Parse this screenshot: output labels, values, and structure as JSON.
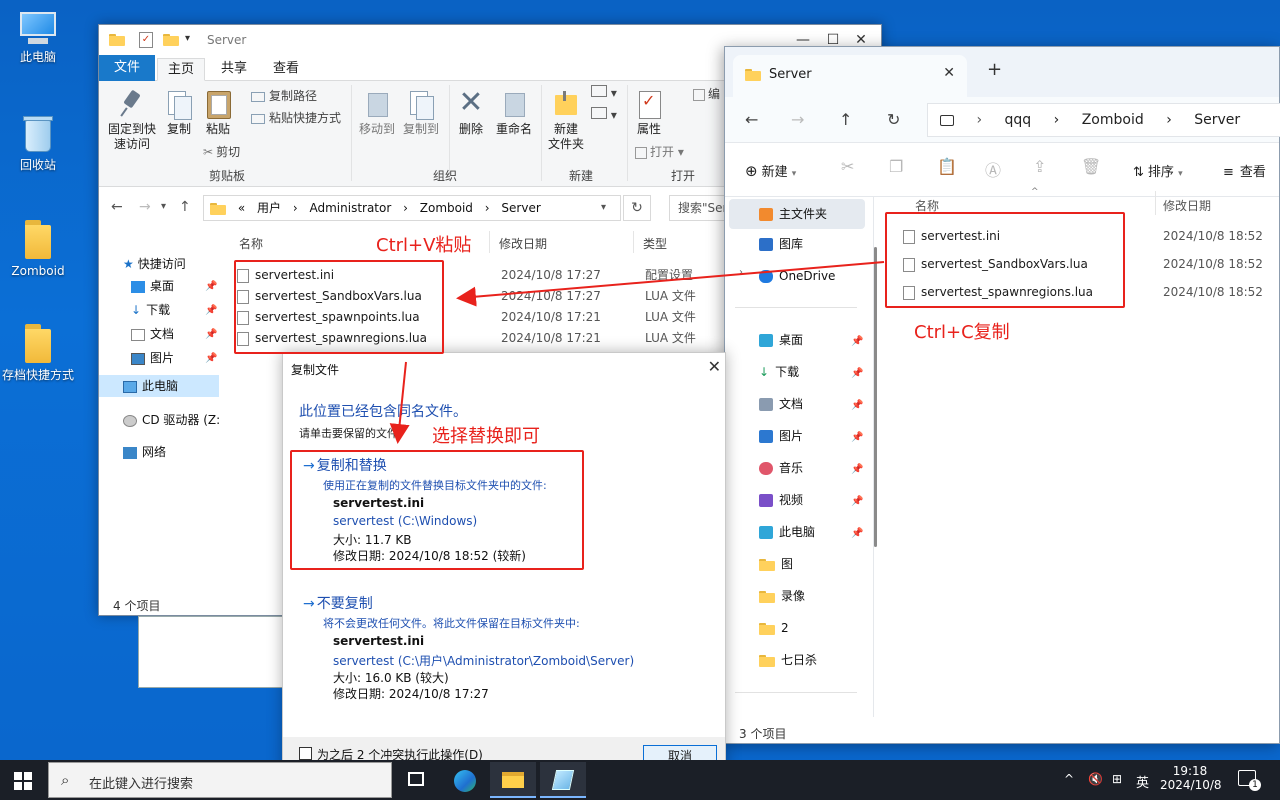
{
  "desktop": {
    "icons": [
      {
        "label": "此电脑",
        "icon": "computer-icon"
      },
      {
        "label": "回收站",
        "icon": "recycle-bin-icon"
      },
      {
        "label": "Zomboid",
        "icon": "folder-icon"
      },
      {
        "label": "存档快捷方式",
        "icon": "shortcut-folder-icon"
      }
    ]
  },
  "win1": {
    "title": "Server",
    "tabs": [
      "文件",
      "主页",
      "共享",
      "查看"
    ],
    "ribbon": {
      "pin_label": [
        "固定到快",
        "速访问"
      ],
      "copy_label": "复制",
      "paste_label": "粘贴",
      "copy_path": "复制路径",
      "paste_shortcut": "粘贴快捷方式",
      "cut": "剪切",
      "clipboard_group": "剪贴板",
      "move_to": "移动到",
      "copy_to": "复制到",
      "delete": "删除",
      "rename": "重命名",
      "organize_group": "组织",
      "new_folder": [
        "新建",
        "文件夹"
      ],
      "new_group": "新建",
      "properties": "属性",
      "open": "打开",
      "edit": "编",
      "open_group": "打开"
    },
    "address": [
      "«",
      "用户",
      "›",
      "Administrator",
      "›",
      "Zomboid",
      "›",
      "Server"
    ],
    "search_placeholder": "搜索\"Ser",
    "nav": {
      "quick_access": "快捷访问",
      "items": [
        "桌面",
        "下载",
        "文档",
        "图片"
      ],
      "this_pc": "此电脑",
      "cd_drive": "CD 驱动器 (Z:",
      "network": "网络"
    },
    "columns": {
      "name": "名称",
      "date": "修改日期",
      "type": "类型"
    },
    "files": [
      {
        "name": "servertest.ini",
        "date": "2024/10/8 17:27",
        "type": "配置设置"
      },
      {
        "name": "servertest_SandboxVars.lua",
        "date": "2024/10/8 17:27",
        "type": "LUA 文件"
      },
      {
        "name": "servertest_spawnpoints.lua",
        "date": "2024/10/8 17:21",
        "type": "LUA 文件"
      },
      {
        "name": "servertest_spawnregions.lua",
        "date": "2024/10/8 17:21",
        "type": "LUA 文件"
      }
    ],
    "status": "4 个项目"
  },
  "win2": {
    "tab_title": "Server",
    "breadcrumb": [
      "qqq",
      "›",
      "Zomboid",
      "›",
      "Server"
    ],
    "toolbar": {
      "new": "新建",
      "sort": "排序",
      "view": "查看"
    },
    "sidebar": {
      "home": "主文件夹",
      "gallery": "图库",
      "onedrive": "OneDrive",
      "items": [
        "桌面",
        "下载",
        "文档",
        "图片",
        "音乐",
        "视频",
        "此电脑",
        "图",
        "录像",
        "2",
        "七日杀"
      ]
    },
    "columns": {
      "name": "名称",
      "date": "修改日期"
    },
    "files": [
      {
        "name": "servertest.ini",
        "date": "2024/10/8 18:52"
      },
      {
        "name": "servertest_SandboxVars.lua",
        "date": "2024/10/8 18:52"
      },
      {
        "name": "servertest_spawnregions.lua",
        "date": "2024/10/8 18:52"
      }
    ],
    "status": "3 个项目"
  },
  "dialog": {
    "title": "复制文件",
    "heading": "此位置已经包含同名文件。",
    "sub": "请单击要保留的文件",
    "replace": {
      "title": "复制和替换",
      "desc": "使用正在复制的文件替换目标文件夹中的文件:",
      "name": "servertest.ini",
      "path": "servertest (C:\\Windows)",
      "size": "大小: 11.7 KB",
      "date": "修改日期: 2024/10/8 18:52 (较新)"
    },
    "skip": {
      "title": "不要复制",
      "desc": "将不会更改任何文件。将此文件保留在目标文件夹中:",
      "name": "servertest.ini",
      "path": "servertest (C:\\用户\\Administrator\\Zomboid\\Server)",
      "size": "大小: 16.0 KB (较大)",
      "date": "修改日期: 2024/10/8 17:27"
    },
    "checkbox": "为之后 2 个冲突执行此操作(D)",
    "cancel": "取消"
  },
  "annotations": {
    "paste": "Ctrl+V粘贴",
    "copy": "Ctrl+C复制",
    "replace": "选择替换即可",
    "color": "#e8221c"
  },
  "taskbar": {
    "search_placeholder": "在此键入进行搜索",
    "ime": "英",
    "time": "19:18",
    "date": "2024/10/8",
    "notifications": "1"
  }
}
